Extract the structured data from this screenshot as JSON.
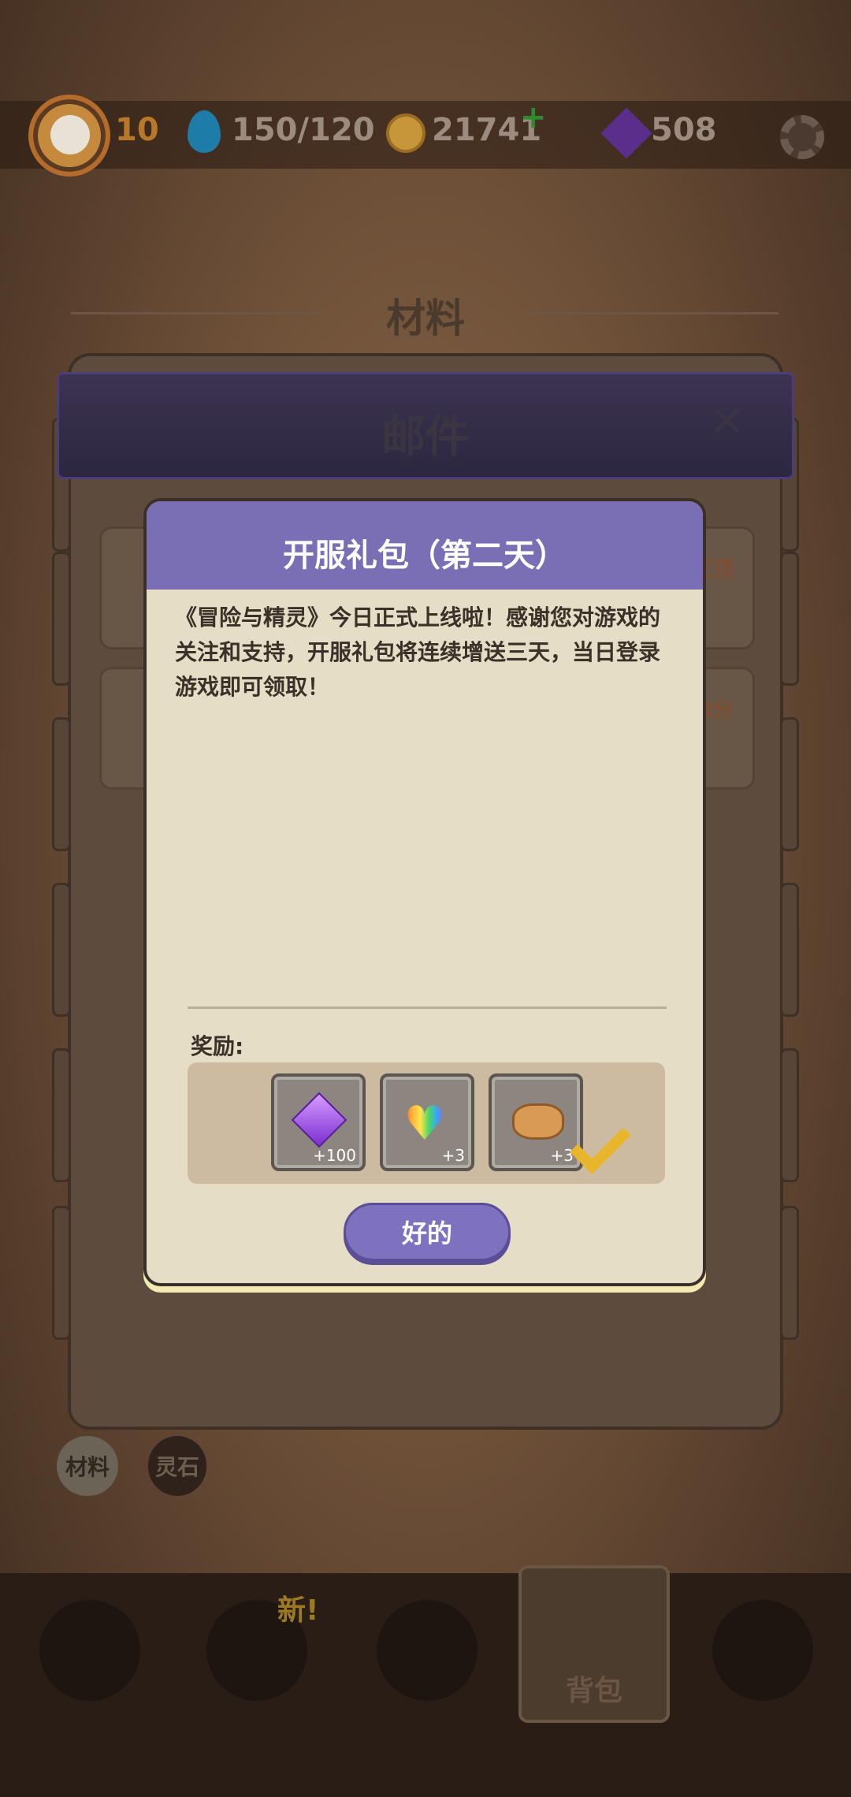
{
  "topbar": {
    "level": "10",
    "energy": "150/120",
    "coins": "21741",
    "gems": "508"
  },
  "background": {
    "section_title": "材料",
    "row_tags": [
      "置顶",
      "8分"
    ],
    "chips": [
      "材料",
      "灵石"
    ],
    "mail_title": "邮件",
    "mail_close": "✕"
  },
  "nav": {
    "new_badge": "新!",
    "active_label": "背包"
  },
  "dialog": {
    "title": "开服礼包（第二天）",
    "body": "《冒险与精灵》今日正式上线啦！感谢您对游戏的关注和支持，开服礼包将连续增送三天，当日登录游戏即可领取！",
    "reward_label": "奖励:",
    "rewards": [
      {
        "icon": "purple-gem",
        "count": "+100"
      },
      {
        "icon": "rainbow-heart",
        "count": "+3"
      },
      {
        "icon": "cookie",
        "count": "+3"
      }
    ],
    "ok_label": "好的"
  },
  "colors": {
    "dialog_header": "#7a6fb5",
    "button": "#7e71c0",
    "check": "#e8b52c"
  }
}
